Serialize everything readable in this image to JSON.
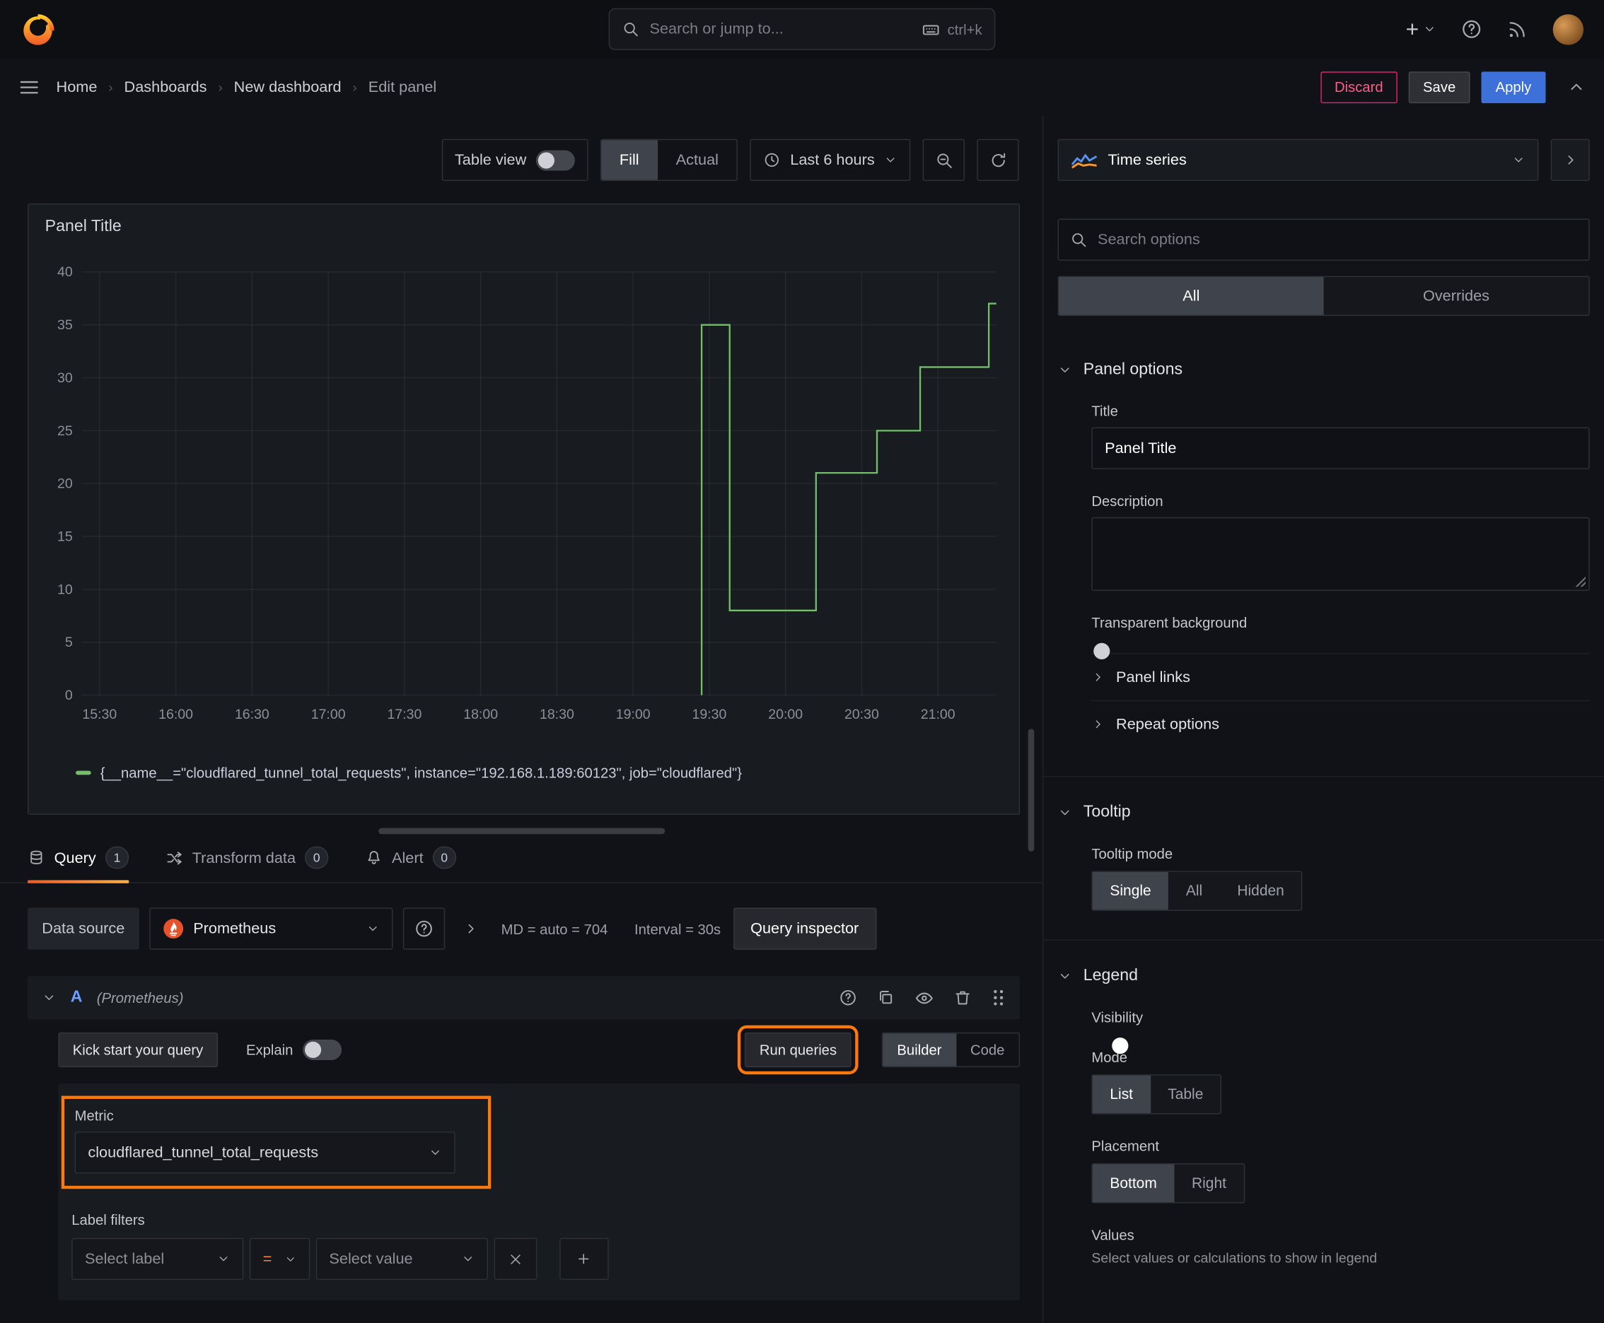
{
  "topbar": {
    "search_placeholder": "Search or jump to...",
    "search_shortcut": "ctrl+k"
  },
  "breadcrumb": {
    "items": [
      "Home",
      "Dashboards",
      "New dashboard",
      "Edit panel"
    ]
  },
  "actions": {
    "discard": "Discard",
    "save": "Save",
    "apply": "Apply"
  },
  "toolbar": {
    "table_view_label": "Table view",
    "fill_label": "Fill",
    "actual_label": "Actual",
    "time_range_label": "Last 6 hours"
  },
  "panel": {
    "title": "Panel Title"
  },
  "chart_data": {
    "type": "line",
    "title": "Panel Title",
    "line_color": "#73bf69",
    "legend_label": "{__name__=\"cloudflared_tunnel_total_requests\", instance=\"192.168.1.189:60123\", job=\"cloudflared\"}",
    "x_ticks": [
      "15:30",
      "16:00",
      "16:30",
      "17:00",
      "17:30",
      "18:00",
      "18:30",
      "19:00",
      "19:30",
      "20:00",
      "20:30",
      "21:00"
    ],
    "tick_interval_minutes": 30,
    "x_domain_minutes": [
      -7,
      353
    ],
    "y_ticks": [
      0,
      5,
      10,
      15,
      20,
      25,
      30,
      35,
      40
    ],
    "ylim": [
      0,
      40
    ],
    "grid": true,
    "legend_position": "bottom",
    "step_points": [
      {
        "t": 237,
        "v": 0
      },
      {
        "t": 237,
        "v": 35
      },
      {
        "t": 248,
        "v": 35
      },
      {
        "t": 248,
        "v": 8
      },
      {
        "t": 282,
        "v": 8
      },
      {
        "t": 282,
        "v": 21
      },
      {
        "t": 306,
        "v": 21
      },
      {
        "t": 306,
        "v": 25
      },
      {
        "t": 323,
        "v": 25
      },
      {
        "t": 323,
        "v": 31
      },
      {
        "t": 350,
        "v": 31
      },
      {
        "t": 350,
        "v": 37
      },
      {
        "t": 353,
        "v": 37
      }
    ]
  },
  "tabs": {
    "query_label": "Query",
    "query_count": "1",
    "transform_label": "Transform data",
    "transform_count": "0",
    "alert_label": "Alert",
    "alert_count": "0"
  },
  "query_toolbar": {
    "datasource_label": "Data source",
    "datasource_name": "Prometheus",
    "stats_md": "MD = auto = 704",
    "stats_interval": "Interval = 30s",
    "inspector_label": "Query inspector"
  },
  "query_row": {
    "ref_id": "A",
    "datasource_hint": "(Prometheus)",
    "kickstart_label": "Kick start your query",
    "explain_label": "Explain",
    "run_label": "Run queries",
    "builder_label": "Builder",
    "code_label": "Code",
    "metric_label": "Metric",
    "metric_value": "cloudflared_tunnel_total_requests",
    "label_filters_label": "Label filters",
    "select_label_placeholder": "Select label",
    "operator_value": "=",
    "select_value_placeholder": "Select value"
  },
  "options_pane": {
    "viz_name": "Time series",
    "search_placeholder": "Search options",
    "tab_all": "All",
    "tab_overrides": "Overrides",
    "panel_options": {
      "header": "Panel options",
      "title_label": "Title",
      "title_value": "Panel Title",
      "description_label": "Description",
      "transparent_label": "Transparent background",
      "links_label": "Panel links",
      "repeat_label": "Repeat options"
    },
    "tooltip": {
      "header": "Tooltip",
      "mode_label": "Tooltip mode",
      "options": [
        "Single",
        "All",
        "Hidden"
      ],
      "selected": "Single"
    },
    "legend": {
      "header": "Legend",
      "visibility_label": "Visibility",
      "mode_label": "Mode",
      "mode_options": [
        "List",
        "Table"
      ],
      "mode_selected": "List",
      "placement_label": "Placement",
      "placement_options": [
        "Bottom",
        "Right"
      ],
      "placement_selected": "Bottom",
      "values_label": "Values",
      "values_description": "Select values or calculations to show in legend"
    }
  },
  "colors": {
    "accent_orange": "#ff8833",
    "highlight_orange": "#ff780a",
    "primary_blue": "#3d71d9",
    "series_green": "#73bf69",
    "danger_red": "#e0226e"
  }
}
